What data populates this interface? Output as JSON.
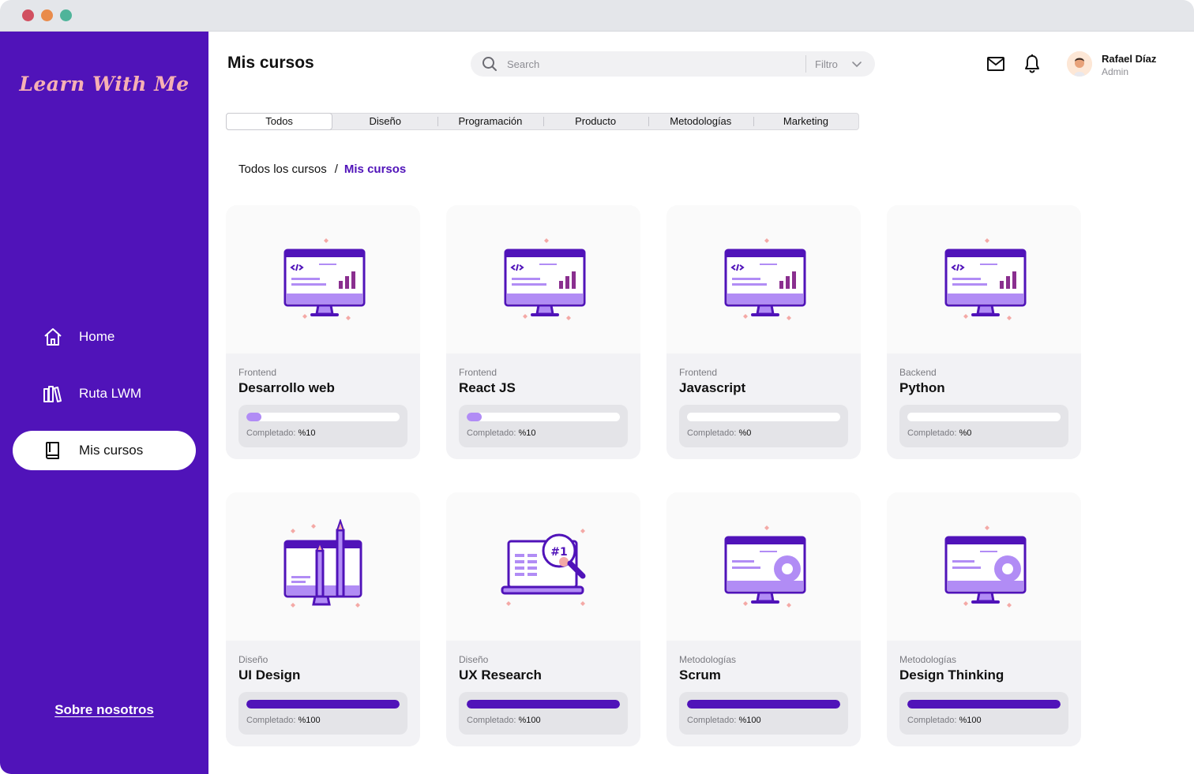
{
  "app": {
    "logo": "Learn With Me",
    "colors": {
      "brand": "#5013b9",
      "accent_light": "#b18cf5",
      "logo_pink": "#f6b0b4"
    }
  },
  "sidebar": {
    "items": [
      {
        "label": "Home",
        "icon": "home-icon",
        "active": false
      },
      {
        "label": "Ruta LWM",
        "icon": "library-icon",
        "active": false
      },
      {
        "label": "Mis cursos",
        "icon": "book-icon",
        "active": true
      }
    ],
    "footer_link": "Sobre nosotros"
  },
  "header": {
    "title": "Mis cursos",
    "search_placeholder": "Search",
    "filter_label": "Filtro",
    "user": {
      "name": "Rafael Díaz",
      "role": "Admin"
    }
  },
  "tabs": [
    "Todos",
    "Diseño",
    "Programación",
    "Producto",
    "Metodologías",
    "Marketing"
  ],
  "active_tab": "Todos",
  "breadcrumb": {
    "root": "Todos los cursos",
    "separator": "/",
    "current": "Mis cursos"
  },
  "progress_prefix": "Completado:",
  "courses": [
    {
      "category": "Frontend",
      "title": "Desarrollo web",
      "progress_label": "%10",
      "progress": 0.1,
      "illustration": "monitor-chart"
    },
    {
      "category": "Frontend",
      "title": "React JS",
      "progress_label": "%10",
      "progress": 0.1,
      "illustration": "monitor-chart"
    },
    {
      "category": "Frontend",
      "title": "Javascript",
      "progress_label": "%0",
      "progress": 0,
      "illustration": "monitor-chart"
    },
    {
      "category": "Backend",
      "title": "Python",
      "progress_label": "%0",
      "progress": 0,
      "illustration": "monitor-chart"
    },
    {
      "category": "Diseño",
      "title": "UI Design",
      "progress_label": "%100",
      "progress": 1,
      "illustration": "monitor-pencils"
    },
    {
      "category": "Diseño",
      "title": "UX Research",
      "progress_label": "%100",
      "progress": 1,
      "illustration": "laptop-magnifier"
    },
    {
      "category": "Metodologías",
      "title": "Scrum",
      "progress_label": "%100",
      "progress": 1,
      "illustration": "monitor-gear"
    },
    {
      "category": "Metodologías",
      "title": "Design Thinking",
      "progress_label": "%100",
      "progress": 1,
      "illustration": "monitor-gear"
    }
  ]
}
